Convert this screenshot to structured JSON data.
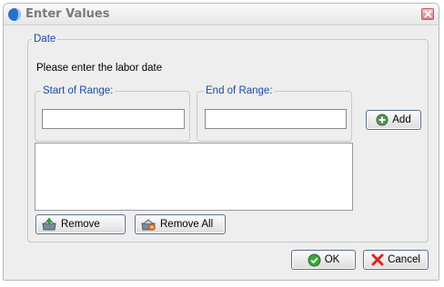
{
  "window": {
    "title": "Enter Values"
  },
  "date_group": {
    "legend": "Date",
    "prompt": "Please enter the labor date",
    "start": {
      "legend": "Start of Range:",
      "value": ""
    },
    "end": {
      "legend": "End of Range:",
      "value": ""
    },
    "list_items": []
  },
  "buttons": {
    "add": "Add",
    "remove": "Remove",
    "remove_all": "Remove All",
    "ok": "OK",
    "cancel": "Cancel"
  },
  "icons": {
    "app": "app-logo-icon",
    "close": "close-icon",
    "add": "plus-circle-icon",
    "remove": "remove-icon",
    "remove_all": "remove-all-icon",
    "ok": "check-circle-icon",
    "cancel": "x-icon"
  },
  "colors": {
    "legend_text": "#1a4aa6",
    "app_icon": "#2a6fc9",
    "close_button": "#dd7e88",
    "ok_icon": "#3aa53a",
    "cancel_icon": "#d9261c"
  }
}
